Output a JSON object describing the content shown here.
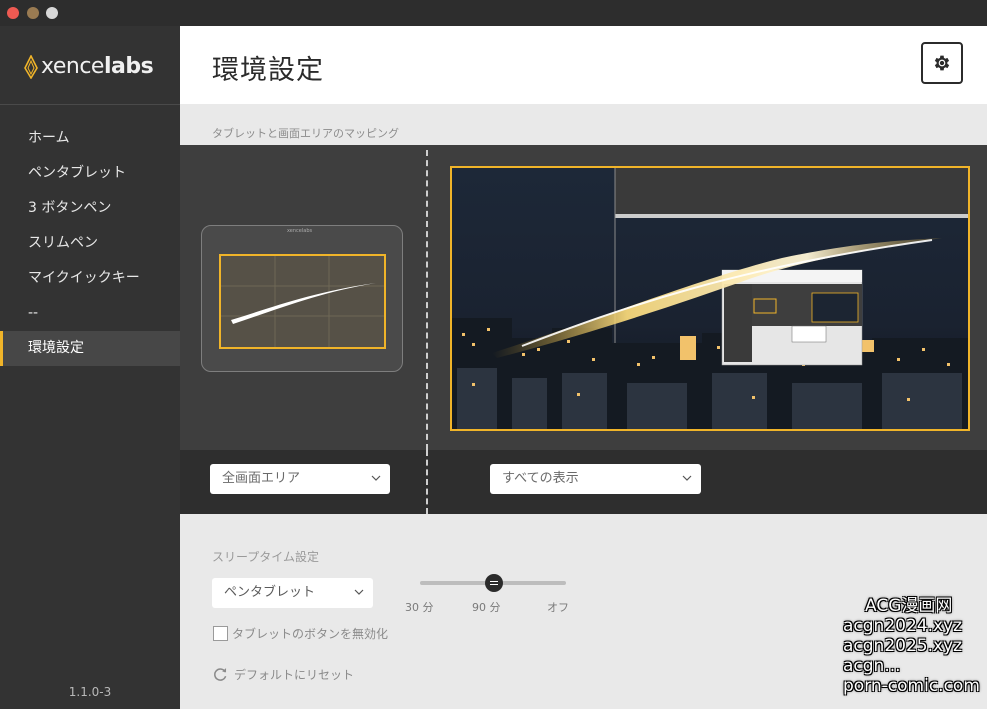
{
  "brand": {
    "logo_text_a": "xence",
    "logo_text_b": "labs"
  },
  "sidebar": {
    "items": [
      {
        "label": "ホーム"
      },
      {
        "label": "ペンタブレット"
      },
      {
        "label": "3 ボタンペン"
      },
      {
        "label": "スリムペン"
      },
      {
        "label": "マイクイックキー"
      },
      {
        "label": "--"
      },
      {
        "label": "環境設定"
      }
    ],
    "active_index": 6,
    "version": "1.1.0-3"
  },
  "header": {
    "title": "環境設定"
  },
  "mapping": {
    "section_label": "タブレットと画面エリアのマッピング",
    "tablet_brand": "xencelabs",
    "tablet_area_select": "全画面エリア",
    "display_select": "すべての表示"
  },
  "sleep": {
    "section_label": "スリープタイム設定",
    "device_select": "ペンタブレット",
    "slider_value": "90 分",
    "ticks": [
      "30 分",
      "90 分",
      "オフ"
    ],
    "disable_buttons_label": "タブレットのボタンを無効化",
    "disable_buttons_checked": false,
    "reset_label": "デフォルトにリセット"
  },
  "watermark": {
    "lines": [
      "ACG漫画网",
      "acgn2024.xyz",
      "acgn2025.xyz",
      "acgn...",
      "porn-comic.com"
    ]
  },
  "colors": {
    "accent": "#f0b429",
    "sidebar_bg": "#333333",
    "panel_bg": "#3e3e3e"
  }
}
